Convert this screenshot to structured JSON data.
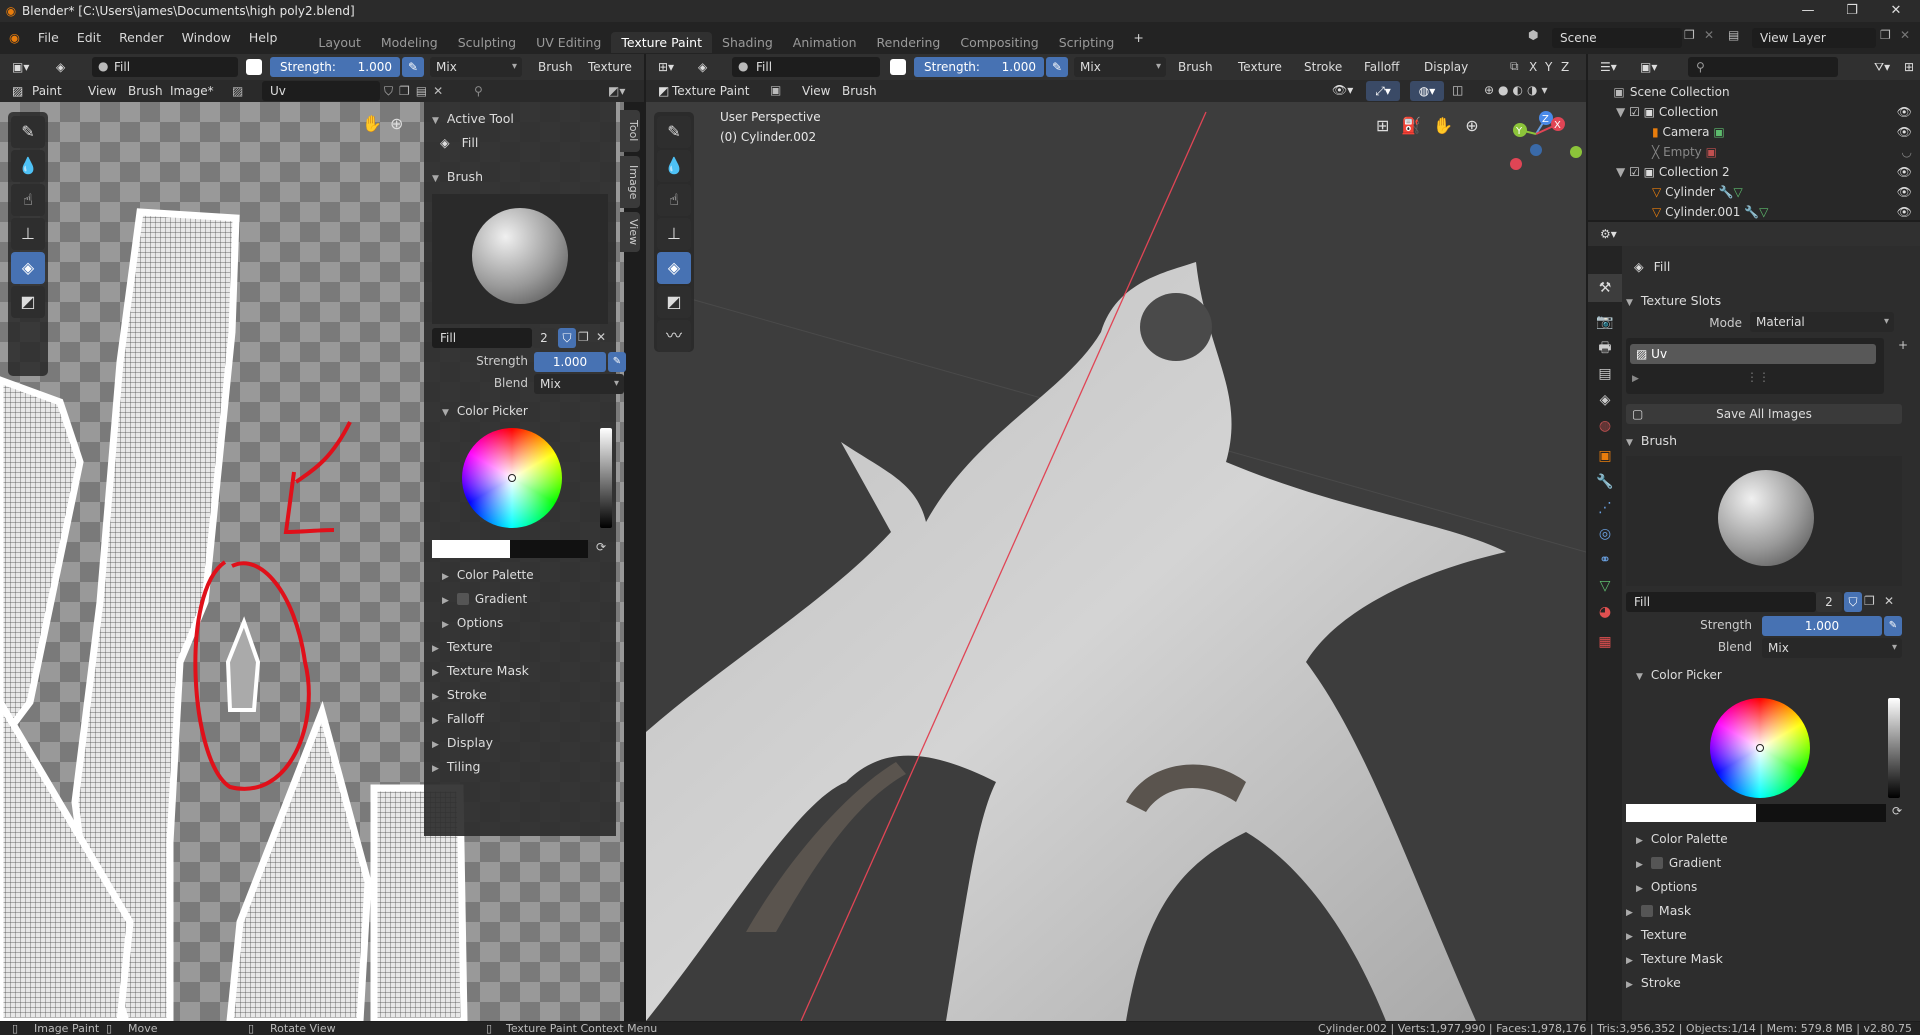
{
  "window": {
    "title": "Blender* [C:\\Users\\james\\Documents\\high poly2.blend]"
  },
  "menu": [
    "File",
    "Edit",
    "Render",
    "Window",
    "Help"
  ],
  "workspaces": [
    "Layout",
    "Modeling",
    "Sculpting",
    "UV Editing",
    "Texture Paint",
    "Shading",
    "Animation",
    "Rendering",
    "Compositing",
    "Scripting"
  ],
  "active_workspace": "Texture Paint",
  "scene": {
    "name": "Scene",
    "view_layer": "View Layer"
  },
  "left_header": {
    "brush": "Fill",
    "strength_label": "Strength:",
    "strength": "1.000",
    "blend": "Mix",
    "brush_menu": "Brush",
    "texture_menu": "Texture"
  },
  "left_header2": {
    "mode": "Paint",
    "view": "View",
    "brush": "Brush",
    "image": "Image*",
    "image_name": "Uv"
  },
  "npanel": {
    "active_tool_title": "Active Tool",
    "tool_name": "Fill",
    "brush_title": "Brush",
    "brush_name": "Fill",
    "brush_users": "2",
    "strength_label": "Strength",
    "strength": "1.000",
    "blend_label": "Blend",
    "blend": "Mix",
    "color_picker": "Color Picker",
    "color_palette": "Color Palette",
    "gradient": "Gradient",
    "options": "Options",
    "sections": [
      "Texture",
      "Texture Mask",
      "Stroke",
      "Falloff",
      "Display",
      "Tiling"
    ],
    "tabs": [
      "Tool",
      "Image",
      "View"
    ]
  },
  "viewport_header": {
    "brush": "Fill",
    "strength_label": "Strength:",
    "strength": "1.000",
    "blend": "Mix",
    "menus": [
      "Brush",
      "Texture",
      "Stroke",
      "Falloff",
      "Display"
    ],
    "axes": [
      "X",
      "Y",
      "Z"
    ]
  },
  "viewport_header2": {
    "mode": "Texture Paint",
    "view": "View",
    "brush": "Brush"
  },
  "viewport": {
    "perspective": "User Perspective",
    "object": "(0) Cylinder.002"
  },
  "outliner": {
    "root": "Scene Collection",
    "items": [
      {
        "name": "Collection",
        "level": 1
      },
      {
        "name": "Camera",
        "level": 2
      },
      {
        "name": "Empty",
        "level": 2
      },
      {
        "name": "Collection 2",
        "level": 1
      },
      {
        "name": "Cylinder",
        "level": 2
      },
      {
        "name": "Cylinder.001",
        "level": 2
      }
    ]
  },
  "properties": {
    "tool_name": "Fill",
    "texture_slots": "Texture Slots",
    "mode_label": "Mode",
    "mode": "Material",
    "slot": "Uv",
    "save_all": "Save All Images",
    "brush_title": "Brush",
    "brush_name": "Fill",
    "brush_users": "2",
    "strength_label": "Strength",
    "strength": "1.000",
    "blend_label": "Blend",
    "blend": "Mix",
    "color_picker": "Color Picker",
    "color_palette": "Color Palette",
    "gradient": "Gradient",
    "options": "Options",
    "mask": "Mask",
    "texture": "Texture",
    "texture_mask": "Texture Mask",
    "stroke": "Stroke"
  },
  "status": {
    "image_paint": "Image Paint",
    "move": "Move",
    "rotate_view": "Rotate View",
    "context_menu": "Texture Paint Context Menu",
    "stats": "Cylinder.002 | Verts:1,977,990 | Faces:1,978,176 | Tris:3,956,352 | Objects:1/14 | Mem: 579.8 MB | v2.80.75"
  },
  "colors": {
    "accent": "#4772b3",
    "header": "#303030",
    "panel": "#2d2d2d",
    "annotation": "#e0101a",
    "axis_x": "#e04555"
  }
}
